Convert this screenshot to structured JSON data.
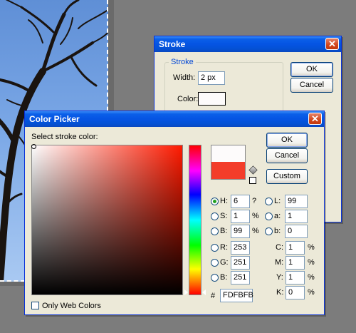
{
  "stroke_dialog": {
    "title": "Stroke",
    "group_label": "Stroke",
    "width_label": "Width:",
    "width_value": "2 px",
    "color_label": "Color:",
    "ok_label": "OK",
    "cancel_label": "Cancel"
  },
  "color_picker": {
    "title": "Color Picker",
    "prompt": "Select stroke color:",
    "ok_label": "OK",
    "cancel_label": "Cancel",
    "custom_label": "Custom",
    "current_color": "#F33D2A",
    "new_color": "#FDFBFB",
    "hsb": [
      {
        "label": "H:",
        "value": "6",
        "unit": "?"
      },
      {
        "label": "S:",
        "value": "1",
        "unit": "%"
      },
      {
        "label": "B:",
        "value": "99",
        "unit": "%"
      }
    ],
    "lab": [
      {
        "label": "L:",
        "value": "99"
      },
      {
        "label": "a:",
        "value": "1"
      },
      {
        "label": "b:",
        "value": "0"
      }
    ],
    "rgb": [
      {
        "label": "R:",
        "value": "253"
      },
      {
        "label": "G:",
        "value": "251"
      },
      {
        "label": "B:",
        "value": "251"
      }
    ],
    "cmyk": [
      {
        "label": "C:",
        "value": "1",
        "unit": "%"
      },
      {
        "label": "M:",
        "value": "1",
        "unit": "%"
      },
      {
        "label": "Y:",
        "value": "1",
        "unit": "%"
      },
      {
        "label": "K:",
        "value": "0",
        "unit": "%"
      }
    ],
    "hex_label": "#",
    "hex_value": "FDFBFB",
    "web_colors_label": "Only Web Colors",
    "selected_mode": "H"
  }
}
